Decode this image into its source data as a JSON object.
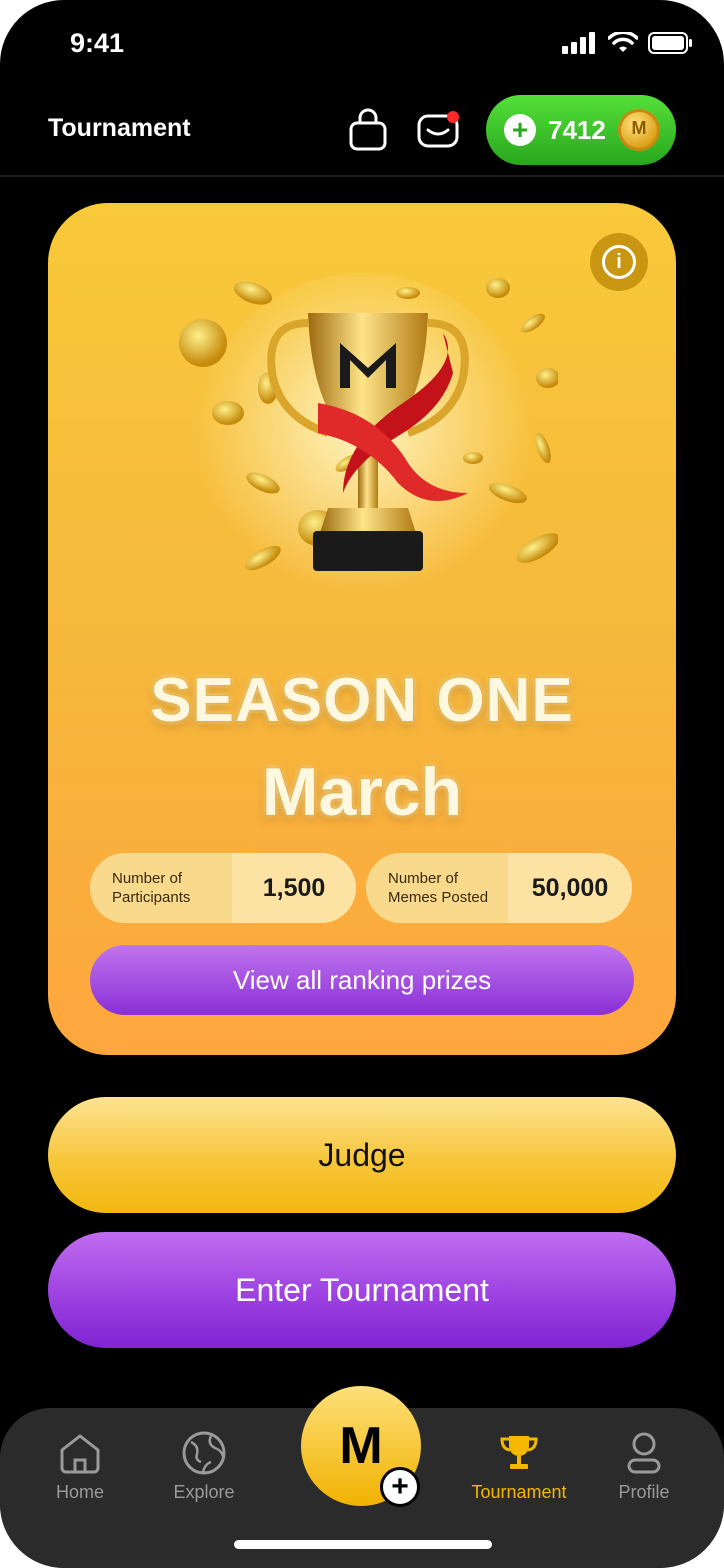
{
  "status_bar": {
    "time": "9:41"
  },
  "header": {
    "title": "Tournament",
    "icons": [
      "shopping-bag-icon",
      "mailbox-icon"
    ],
    "coins": {
      "amount": "7412"
    }
  },
  "season_card": {
    "title": "SEASON ONE",
    "month": "March",
    "stats": [
      {
        "label": "Number of Participants",
        "value": "1,500"
      },
      {
        "label": "Number of Memes Posted",
        "value": "50,000"
      }
    ],
    "ranking_button": "View all ranking prizes"
  },
  "actions": {
    "judge": "Judge",
    "enter": "Enter Tournament"
  },
  "tabbar": {
    "items": [
      {
        "label": "Home",
        "icon": "home-icon"
      },
      {
        "label": "Explore",
        "icon": "globe-icon"
      },
      {
        "label": "M",
        "icon": "create-meme-icon"
      },
      {
        "label": "Tournament",
        "icon": "trophy-icon",
        "active": true
      },
      {
        "label": "Profile",
        "icon": "user-icon"
      }
    ]
  },
  "colors": {
    "accent_yellow": "#f5b800",
    "accent_purple": "#8a2fd6",
    "coin_green": "#2aa71e",
    "background": "#000000"
  }
}
